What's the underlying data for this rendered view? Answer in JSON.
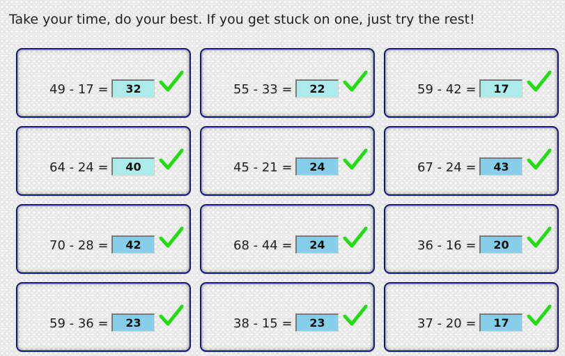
{
  "instructions": "Take your time, do your best. If you get stuck on one, just try the rest!",
  "colors": {
    "answer_light": "#aeecec",
    "answer_dark": "#87ceeb",
    "check": "#22dd11",
    "card_border": "#15157a"
  },
  "problems": [
    {
      "question": "49 - 17 =",
      "answer": "32",
      "status": "correct",
      "highlight": "light"
    },
    {
      "question": "55 - 33 =",
      "answer": "22",
      "status": "correct",
      "highlight": "light"
    },
    {
      "question": "59 - 42 =",
      "answer": "17",
      "status": "correct",
      "highlight": "light"
    },
    {
      "question": "64 - 24 =",
      "answer": "40",
      "status": "correct",
      "highlight": "light"
    },
    {
      "question": "45 - 21 =",
      "answer": "24",
      "status": "correct",
      "highlight": "dark"
    },
    {
      "question": "67 - 24 =",
      "answer": "43",
      "status": "correct",
      "highlight": "dark"
    },
    {
      "question": "70 - 28 =",
      "answer": "42",
      "status": "correct",
      "highlight": "dark"
    },
    {
      "question": "68 - 44 =",
      "answer": "24",
      "status": "correct",
      "highlight": "dark"
    },
    {
      "question": "36 - 16 =",
      "answer": "20",
      "status": "correct",
      "highlight": "dark"
    },
    {
      "question": "59 - 36 =",
      "answer": "23",
      "status": "correct",
      "highlight": "dark"
    },
    {
      "question": "38 - 15 =",
      "answer": "23",
      "status": "correct",
      "highlight": "dark"
    },
    {
      "question": "37 - 20 =",
      "answer": "17",
      "status": "correct",
      "highlight": "dark"
    }
  ]
}
